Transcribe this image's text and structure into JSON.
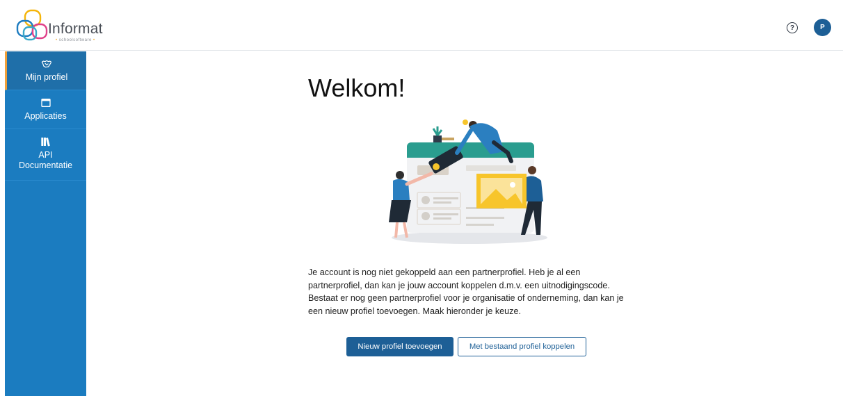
{
  "header": {
    "logo": {
      "wordmark": "Informat",
      "tagline": "schoolsoftware"
    },
    "help_icon_glyph": "?",
    "help_icon_name": "help-circle-icon",
    "avatar_initial": "P"
  },
  "sidebar": {
    "items": [
      {
        "label": "Mijn profiel",
        "icon": "handshake-icon",
        "active": true
      },
      {
        "label": "Applicaties",
        "icon": "app-window-icon",
        "active": false
      },
      {
        "label": "API Documentatie",
        "icon": "books-icon",
        "active": false
      }
    ]
  },
  "main": {
    "title": "Welkom!",
    "intro": "Je account is nog niet gekoppeld aan een partnerprofiel. Heb je al een partnerprofiel, dan kan je jouw account koppelen d.m.v. een uitnodigingscode. Bestaat er nog geen partnerprofiel voor je organisatie of onderneming, dan kan je een nieuw profiel toevoegen. Maak hieronder je keuze.",
    "primary_button": "Nieuw profiel toevoegen",
    "secondary_button": "Met bestaand profiel koppelen"
  },
  "colors": {
    "sidebar": "#1b7cc0",
    "sidebar_active": "#1f6fa9",
    "active_indicator": "#f0a03a",
    "primary": "#1d5f96",
    "illustration_teal": "#2a9d8f",
    "illustration_yellow": "#f7c52b"
  }
}
